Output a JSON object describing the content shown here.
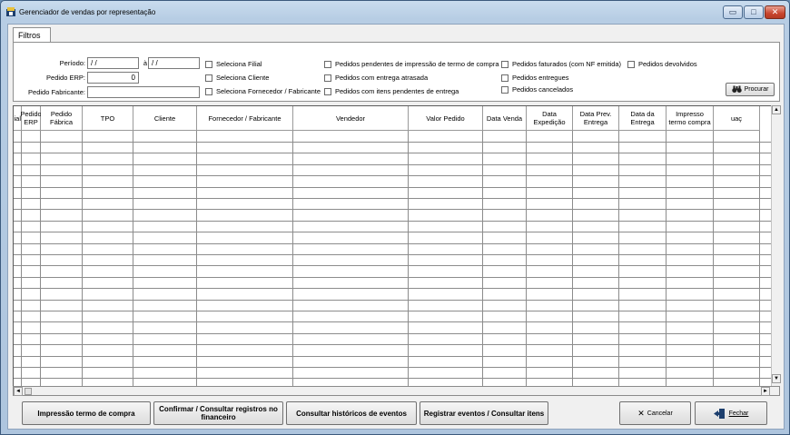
{
  "window": {
    "title": "Gerenciador de vendas por representação"
  },
  "tabs": {
    "filtros": "Filtros"
  },
  "filters": {
    "periodo_label": "Período:",
    "periodo_from": " /  /",
    "periodo_sep": "à",
    "periodo_to": " /  /",
    "pedido_erp_label": "Pedido ERP:",
    "pedido_erp_value": "0",
    "pedido_fabricante_label": "Pedido Fabricante:",
    "pedido_fabricante_value": "",
    "checks": {
      "seleciona_filial": "Seleciona Filial",
      "seleciona_cliente": "Seleciona Cliente",
      "seleciona_fornecedor": "Seleciona Fornecedor / Fabricante",
      "pend_impressao": "Pedidos pendentes de impressão de termo de compra",
      "entrega_atrasada": "Pedidos com entrega atrasada",
      "itens_pendentes": "Pedidos com itens pendentes de entrega",
      "faturados": "Pedidos faturados (com NF emitida)",
      "entregues": "Pedidos entregues",
      "cancelados": "Pedidos cancelados",
      "devolvidos": "Pedidos devolvidos"
    },
    "procurar": "Procurar"
  },
  "grid": {
    "columns": [
      "Filial",
      "Pedido ERP",
      "Pedido Fábrica",
      "TPO",
      "Cliente",
      "Fornecedor / Fabricante",
      "Vendedor",
      "Valor Pedido",
      "Data Venda",
      "Data Expedição",
      "Data Prev. Entrega",
      "Data da Entrega",
      "Impresso termo compra",
      "uaç"
    ]
  },
  "buttons": {
    "impressao": "Impressão termo de compra",
    "confirmar": "Confirmar / Consultar registros no financeiro",
    "historicos": "Consultar históricos de eventos",
    "registrar": "Registrar eventos / Consultar itens",
    "cancelar": "Cancelar",
    "fechar": "Fechar"
  },
  "colors": {
    "titlebar": "#b7cde4",
    "close": "#c8452e"
  },
  "icons": {
    "app": "app-icon",
    "search": "binoculars-icon",
    "cancel": "cancel-icon",
    "exit": "exit-door-icon"
  }
}
